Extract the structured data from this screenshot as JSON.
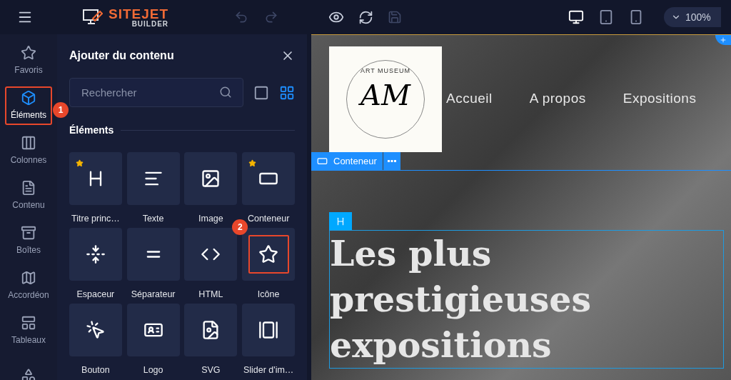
{
  "topbar": {
    "brand": "SITEJET",
    "brand_sub": "BUILDER",
    "devices": [
      {
        "kind": "desktop",
        "selected": true
      },
      {
        "kind": "tablet",
        "selected": false
      },
      {
        "kind": "phone",
        "selected": false
      }
    ],
    "zoom": "100%"
  },
  "rail": [
    {
      "kind": "favorites",
      "label": "Favoris",
      "selected": false
    },
    {
      "kind": "elements",
      "label": "Éléments",
      "selected": true,
      "badge": "1"
    },
    {
      "kind": "columns",
      "label": "Colonnes",
      "selected": false
    },
    {
      "kind": "content",
      "label": "Contenu",
      "selected": false
    },
    {
      "kind": "boxes",
      "label": "Boîtes",
      "selected": false
    },
    {
      "kind": "accordion",
      "label": "Accordéon",
      "selected": false
    },
    {
      "kind": "tables",
      "label": "Tableaux",
      "selected": false
    },
    {
      "kind": "more",
      "selected": false
    }
  ],
  "panel": {
    "title": "Ajouter du contenu",
    "search": {
      "placeholder": "Rechercher"
    },
    "views": [
      {
        "kind": "single",
        "selected": false
      },
      {
        "kind": "grid",
        "selected": true
      }
    ],
    "section": "Éléments",
    "tiles": [
      {
        "kind": "heading",
        "label": "Titre princ…",
        "favorite": true,
        "highlighted": false
      },
      {
        "kind": "text",
        "label": "Texte",
        "favorite": false,
        "highlighted": false
      },
      {
        "kind": "image",
        "label": "Image",
        "favorite": false,
        "highlighted": false
      },
      {
        "kind": "container",
        "label": "Conteneur",
        "favorite": true,
        "highlighted": false
      },
      {
        "kind": "spacer",
        "label": "Espaceur",
        "favorite": false,
        "highlighted": false
      },
      {
        "kind": "separator",
        "label": "Séparateur",
        "favorite": false,
        "highlighted": false
      },
      {
        "kind": "html",
        "label": "HTML",
        "favorite": false,
        "highlighted": false
      },
      {
        "kind": "icon",
        "label": "Icône",
        "favorite": false,
        "highlighted": true,
        "badge": "2"
      },
      {
        "kind": "button",
        "label": "Bouton",
        "favorite": false,
        "highlighted": false
      },
      {
        "kind": "logo",
        "label": "Logo",
        "favorite": false,
        "highlighted": false
      },
      {
        "kind": "svg",
        "label": "SVG",
        "favorite": false,
        "highlighted": false
      },
      {
        "kind": "slider",
        "label": "Slider d'im…",
        "favorite": false,
        "highlighted": false
      }
    ]
  },
  "canvas": {
    "logo": {
      "ring_text": "ART MUSEUM",
      "monogram": "AM"
    },
    "nav": [
      "Accueil",
      "A propos",
      "Expositions"
    ],
    "container_label": "Conteneur",
    "heading": "Les plus prestigieuses expositions"
  }
}
